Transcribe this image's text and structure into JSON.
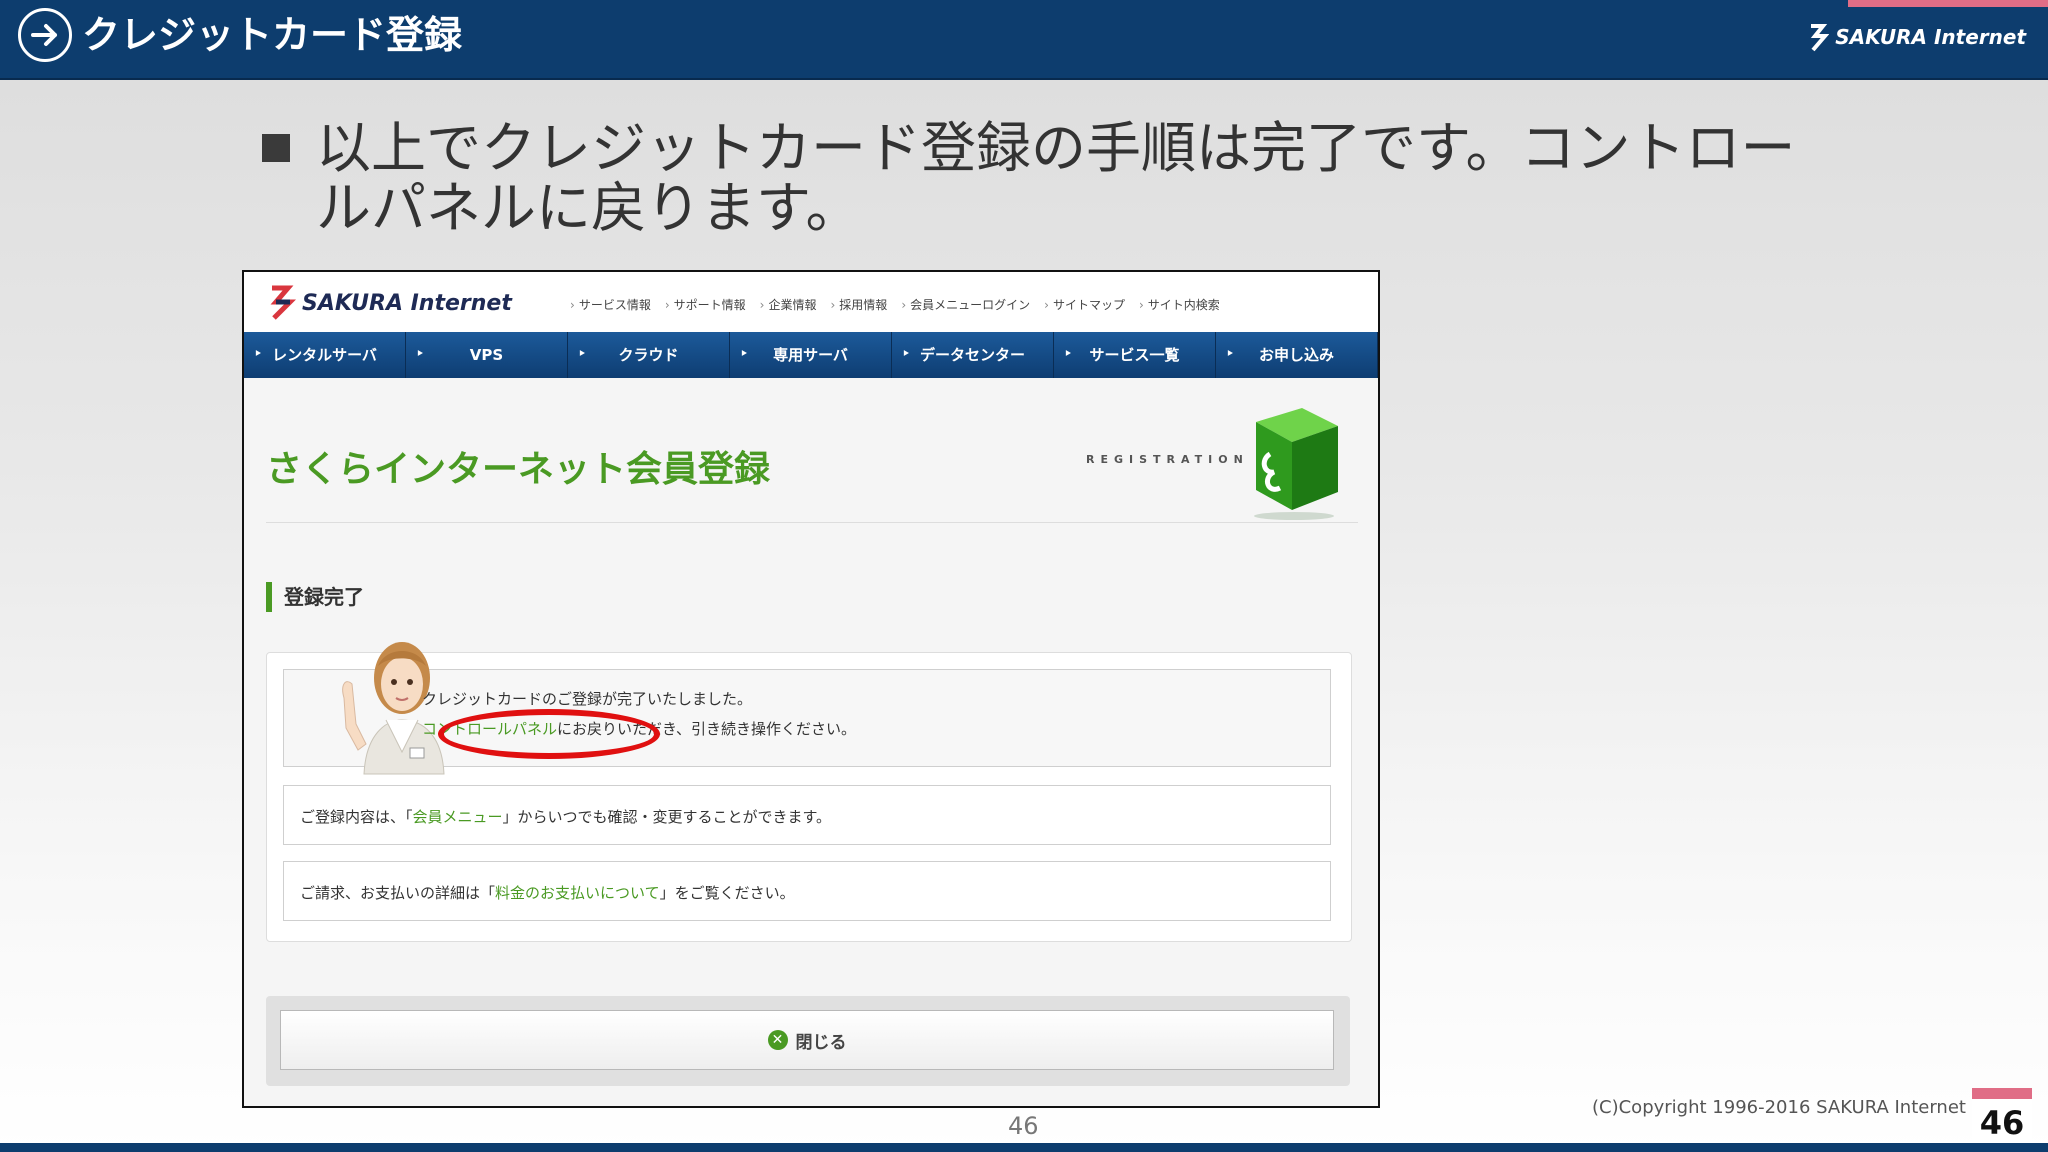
{
  "slide": {
    "title": "クレジットカード登録",
    "brand": "SAKURA Internet",
    "bullet": "以上でクレジットカード登録の手順は完了です。コントロールパネルに戻ります。",
    "copyright": "(C)Copyright 1996-2016 SAKURA Internet Inc.",
    "page_center": "46",
    "page_badge": "46"
  },
  "screenshot": {
    "logo": "SAKURA Internet",
    "top_links": [
      "サービス情報",
      "サポート情報",
      "企業情報",
      "採用情報",
      "会員メニューログイン",
      "サイトマップ",
      "サイト内検索"
    ],
    "nav": [
      "レンタルサーバ",
      "VPS",
      "クラウド",
      "専用サーバ",
      "データセンター",
      "サービス一覧",
      "お申し込み"
    ],
    "page_title": "さくらインターネット会員登録",
    "registration_label": "REGISTRATION",
    "section_heading": "登録完了",
    "message": {
      "line1": "クレジットカードのご登録が完了いたしました。",
      "link": "コントロールパネル",
      "line2_rest": "にお戻りいただき、引き続き操作ください。"
    },
    "info1": {
      "pre": "ご登録内容は、「",
      "link": "会員メニュー",
      "post": "」からいつでも確認・変更することができます。"
    },
    "info2": {
      "pre": "ご請求、お支払いの詳細は「",
      "link": "料金のお支払いについて",
      "post": "」をご覧ください。"
    },
    "close_button": "閉じる"
  },
  "colors": {
    "header_navy": "#0d3d6e",
    "accent_pink": "#e06d86",
    "sakura_green": "#4a9a23",
    "highlight_red": "#e01010"
  }
}
